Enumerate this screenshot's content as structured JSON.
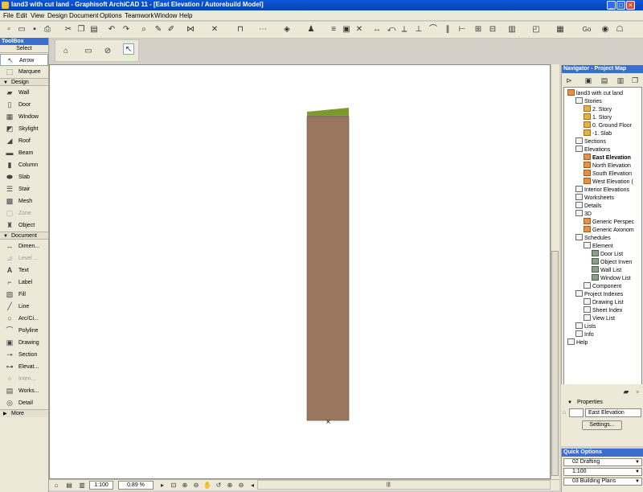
{
  "window": {
    "title": "land3 with cut land - Graphisoft ArchiCAD 11 - [East Elevation / Autorebuild Model]",
    "buttons": [
      "_",
      "□",
      "×"
    ]
  },
  "menu": [
    "File",
    "Edit",
    "View",
    "Design",
    "Document",
    "Options",
    "Teamwork",
    "Window",
    "Help"
  ],
  "toolbar": {
    "go_label": "Go"
  },
  "toolbox": {
    "title": "ToolBox",
    "select_header": "Select",
    "select_items": [
      {
        "label": "Arrow",
        "icon": "arrow-icon"
      },
      {
        "label": "Marquee",
        "icon": "marquee-icon"
      }
    ],
    "design_header": "Design",
    "design_items": [
      {
        "label": "Wall"
      },
      {
        "label": "Door"
      },
      {
        "label": "Window"
      },
      {
        "label": "Skylight"
      },
      {
        "label": "Roof"
      },
      {
        "label": "Beam"
      },
      {
        "label": "Column"
      },
      {
        "label": "Slab"
      },
      {
        "label": "Stair"
      },
      {
        "label": "Mesh"
      },
      {
        "label": "Zone"
      },
      {
        "label": "Object"
      }
    ],
    "document_header": "Document",
    "document_items": [
      {
        "label": "Dimen..."
      },
      {
        "label": "Level ..."
      },
      {
        "label": "Text"
      },
      {
        "label": "Label"
      },
      {
        "label": "Fill"
      },
      {
        "label": "Line"
      },
      {
        "label": "Arc/Ci..."
      },
      {
        "label": "Polyline"
      },
      {
        "label": "Drawing"
      },
      {
        "label": "Section"
      },
      {
        "label": "Elevat..."
      },
      {
        "label": "Interi..."
      },
      {
        "label": "Works..."
      },
      {
        "label": "Detail"
      }
    ],
    "more_label": "More"
  },
  "colors": {
    "soil": "#98775e",
    "grass": "#7a9a2a",
    "panel_header": "#3a6fd0"
  },
  "status": {
    "scale": "1:100",
    "zoom": "0.89 %"
  },
  "navigator": {
    "title": "Navigator - Project Map",
    "tree": [
      {
        "label": "land3 with cut land",
        "level": 0,
        "icon": "house"
      },
      {
        "label": "Stories",
        "level": 1,
        "icon": "doc"
      },
      {
        "label": "2. Story",
        "level": 2,
        "icon": "folder"
      },
      {
        "label": "1. Story",
        "level": 2,
        "icon": "folder"
      },
      {
        "label": "0. Ground Floor",
        "level": 2,
        "icon": "folder"
      },
      {
        "label": "-1. Slab",
        "level": 2,
        "icon": "folder"
      },
      {
        "label": "Sections",
        "level": 1,
        "icon": "doc"
      },
      {
        "label": "Elevations",
        "level": 1,
        "icon": "doc"
      },
      {
        "label": "East Elevation",
        "level": 2,
        "icon": "house",
        "selected": true
      },
      {
        "label": "North Elevation",
        "level": 2,
        "icon": "house"
      },
      {
        "label": "South Elevation",
        "level": 2,
        "icon": "house"
      },
      {
        "label": "West Elevation (",
        "level": 2,
        "icon": "house"
      },
      {
        "label": "Interior Elevations",
        "level": 1,
        "icon": "doc"
      },
      {
        "label": "Worksheets",
        "level": 1,
        "icon": "doc"
      },
      {
        "label": "Details",
        "level": 1,
        "icon": "doc"
      },
      {
        "label": "3D",
        "level": 1,
        "icon": "doc"
      },
      {
        "label": "Generic Perspec",
        "level": 2,
        "icon": "house"
      },
      {
        "label": "Generic Axonom",
        "level": 2,
        "icon": "house"
      },
      {
        "label": "Schedules",
        "level": 1,
        "icon": "doc"
      },
      {
        "label": "Element",
        "level": 2,
        "icon": "doc"
      },
      {
        "label": "Door List",
        "level": 3,
        "icon": "list"
      },
      {
        "label": "Object Inven",
        "level": 3,
        "icon": "list"
      },
      {
        "label": "Wall List",
        "level": 3,
        "icon": "list"
      },
      {
        "label": "Window List",
        "level": 3,
        "icon": "list"
      },
      {
        "label": "Component",
        "level": 2,
        "icon": "doc"
      },
      {
        "label": "Project Indexes",
        "level": 1,
        "icon": "doc"
      },
      {
        "label": "Drawing List",
        "level": 2,
        "icon": "doc"
      },
      {
        "label": "Sheet Index",
        "level": 2,
        "icon": "doc"
      },
      {
        "label": "View List",
        "level": 2,
        "icon": "doc"
      },
      {
        "label": "Lists",
        "level": 1,
        "icon": "doc"
      },
      {
        "label": "Info",
        "level": 1,
        "icon": "doc"
      },
      {
        "label": "Help",
        "level": 0,
        "icon": "doc"
      }
    ]
  },
  "properties": {
    "title": "Properties",
    "view_name": "East Elevation",
    "settings_label": "Settings..."
  },
  "quick_options": {
    "title": "Quick Options",
    "rows": [
      {
        "label": "02 Drafting"
      },
      {
        "label": "1:100"
      },
      {
        "label": "03 Building Plans"
      }
    ]
  }
}
